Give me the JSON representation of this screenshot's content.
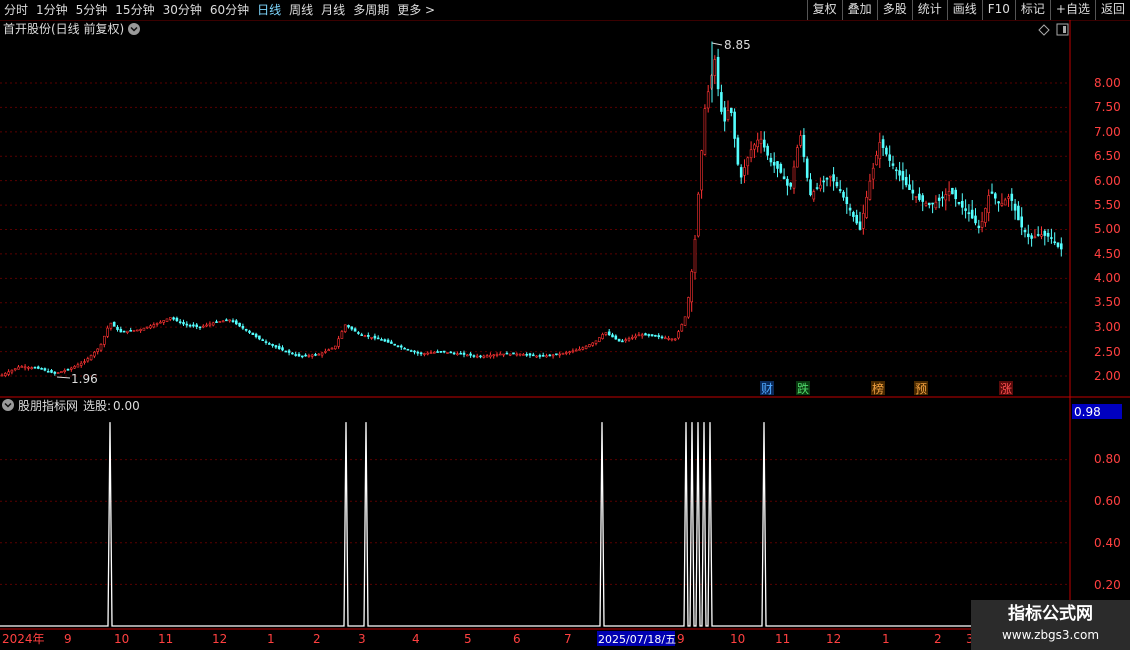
{
  "toolbar": {
    "periods": [
      "分时",
      "1分钟",
      "5分钟",
      "15分钟",
      "30分钟",
      "60分钟",
      "日线",
      "周线",
      "月线",
      "多周期",
      "更多 >"
    ],
    "active_index": 6,
    "buttons": [
      "复权",
      "叠加",
      "多股",
      "统计",
      "画线",
      "F10",
      "标记",
      "+自选",
      "返回"
    ]
  },
  "main_chart": {
    "title": "首开股份(日线 前复权)",
    "high_label": "8.85",
    "low_label": "1.96",
    "y_ticks": [
      "8.00",
      "7.50",
      "7.00",
      "6.50",
      "6.00",
      "5.50",
      "5.00",
      "4.50",
      "4.00",
      "3.50",
      "3.00",
      "2.50",
      "2.00"
    ],
    "event_markers": [
      {
        "text": "财",
        "color": "#2f6fd6"
      },
      {
        "text": "跌",
        "color": "#1f9a3a"
      },
      {
        "text": "榜",
        "color": "#c07020"
      },
      {
        "text": "预",
        "color": "#c07020"
      },
      {
        "text": "涨",
        "color": "#c02020"
      }
    ]
  },
  "indicator": {
    "title": "股朋指标网",
    "name": "选股",
    "value": "0.00",
    "current_value": "0.98",
    "y_ticks": [
      "0.80",
      "0.60",
      "0.40",
      "0.20"
    ]
  },
  "x_axis": {
    "labels": [
      "2024年",
      "9",
      "10",
      "11",
      "12",
      "1",
      "2",
      "3",
      "4",
      "5",
      "6",
      "7",
      "2025/07/18/五",
      "9",
      "10",
      "11",
      "12",
      "1",
      "2",
      "3"
    ]
  },
  "watermark": {
    "line1": "指标公式网",
    "line2": "www.zbgs3.com"
  },
  "chart_data": {
    "type": "candlestick",
    "title": "首开股份(日线 前复权)",
    "ylim": [
      1.9,
      9.0
    ],
    "series": [
      {
        "name": "close",
        "points": [
          [
            0,
            2.0
          ],
          [
            20,
            2.2
          ],
          [
            40,
            2.15
          ],
          [
            55,
            2.05
          ],
          [
            70,
            2.15
          ],
          [
            85,
            2.3
          ],
          [
            100,
            2.6
          ],
          [
            110,
            3.1
          ],
          [
            120,
            2.9
          ],
          [
            140,
            2.95
          ],
          [
            160,
            3.1
          ],
          [
            170,
            3.2
          ],
          [
            185,
            3.05
          ],
          [
            200,
            3.0
          ],
          [
            215,
            3.1
          ],
          [
            230,
            3.15
          ],
          [
            245,
            2.95
          ],
          [
            260,
            2.75
          ],
          [
            280,
            2.55
          ],
          [
            300,
            2.4
          ],
          [
            320,
            2.45
          ],
          [
            335,
            2.6
          ],
          [
            345,
            3.05
          ],
          [
            360,
            2.85
          ],
          [
            380,
            2.75
          ],
          [
            400,
            2.6
          ],
          [
            420,
            2.45
          ],
          [
            440,
            2.5
          ],
          [
            460,
            2.45
          ],
          [
            480,
            2.4
          ],
          [
            500,
            2.45
          ],
          [
            520,
            2.45
          ],
          [
            540,
            2.4
          ],
          [
            560,
            2.45
          ],
          [
            580,
            2.55
          ],
          [
            595,
            2.7
          ],
          [
            605,
            2.9
          ],
          [
            620,
            2.7
          ],
          [
            640,
            2.85
          ],
          [
            660,
            2.8
          ],
          [
            675,
            2.75
          ],
          [
            685,
            3.2
          ],
          [
            690,
            3.8
          ],
          [
            695,
            4.8
          ],
          [
            700,
            6.2
          ],
          [
            705,
            7.5
          ],
          [
            710,
            8.0
          ],
          [
            715,
            8.5
          ],
          [
            720,
            7.5
          ],
          [
            725,
            7.2
          ],
          [
            730,
            7.6
          ],
          [
            740,
            6.0
          ],
          [
            750,
            6.6
          ],
          [
            760,
            6.9
          ],
          [
            770,
            6.4
          ],
          [
            780,
            6.2
          ],
          [
            790,
            5.8
          ],
          [
            800,
            7.0
          ],
          [
            810,
            5.7
          ],
          [
            820,
            5.9
          ],
          [
            830,
            6.1
          ],
          [
            840,
            5.8
          ],
          [
            850,
            5.4
          ],
          [
            860,
            5.0
          ],
          [
            870,
            6.0
          ],
          [
            880,
            6.8
          ],
          [
            890,
            6.4
          ],
          [
            900,
            6.1
          ],
          [
            910,
            5.8
          ],
          [
            920,
            5.6
          ],
          [
            930,
            5.5
          ],
          [
            940,
            5.6
          ],
          [
            950,
            5.8
          ],
          [
            960,
            5.5
          ],
          [
            970,
            5.3
          ],
          [
            980,
            5.0
          ],
          [
            990,
            5.8
          ],
          [
            1000,
            5.5
          ],
          [
            1010,
            5.7
          ],
          [
            1020,
            5.1
          ],
          [
            1030,
            4.8
          ],
          [
            1040,
            4.9
          ],
          [
            1050,
            4.85
          ],
          [
            1060,
            4.6
          ]
        ]
      }
    ]
  }
}
